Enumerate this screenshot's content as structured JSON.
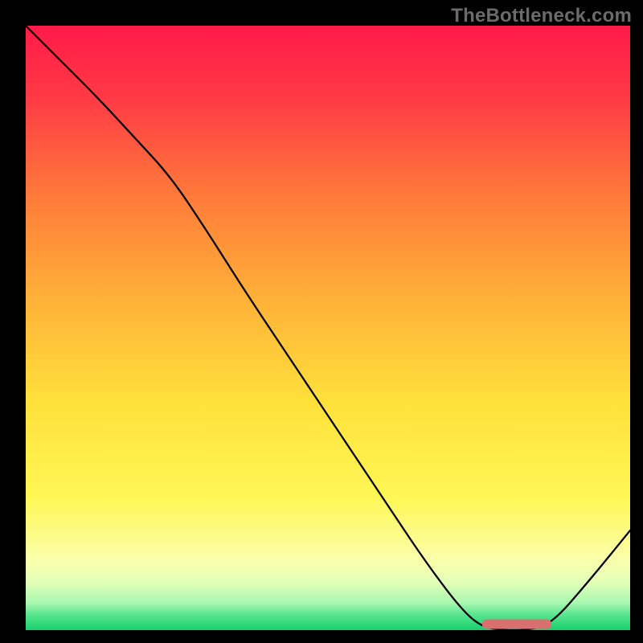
{
  "watermark": "TheBottleneck.com",
  "chart_data": {
    "type": "line",
    "title": "",
    "xlabel": "",
    "ylabel": "",
    "xlim": [
      0,
      1
    ],
    "ylim": [
      0,
      1
    ],
    "series": [
      {
        "name": "curve",
        "x": [
          0.0,
          0.06,
          0.12,
          0.18,
          0.24,
          0.3,
          0.36,
          0.42,
          0.48,
          0.54,
          0.6,
          0.66,
          0.72,
          0.755,
          0.79,
          0.83,
          0.87,
          0.935,
          1.0
        ],
        "y": [
          1.0,
          0.94,
          0.88,
          0.815,
          0.75,
          0.66,
          0.565,
          0.475,
          0.385,
          0.295,
          0.205,
          0.115,
          0.035,
          0.005,
          0.0,
          0.0,
          0.01,
          0.085,
          0.165
        ]
      }
    ],
    "markers": [
      {
        "name": "optimal-bar",
        "shape": "rounded-rect",
        "color": "#d9706f",
        "x_start": 0.755,
        "x_end": 0.87,
        "y": 0.002,
        "height": 0.016
      }
    ],
    "background_gradient": {
      "direction": "top-to-bottom",
      "stops": [
        {
          "pos": 0.0,
          "color": "#ff1a49"
        },
        {
          "pos": 0.12,
          "color": "#ff3a45"
        },
        {
          "pos": 0.28,
          "color": "#ff7a3a"
        },
        {
          "pos": 0.45,
          "color": "#ffb038"
        },
        {
          "pos": 0.62,
          "color": "#ffe03a"
        },
        {
          "pos": 0.78,
          "color": "#fff755"
        },
        {
          "pos": 0.88,
          "color": "#fbffa8"
        },
        {
          "pos": 0.92,
          "color": "#e4ffb8"
        },
        {
          "pos": 0.955,
          "color": "#a8f8b0"
        },
        {
          "pos": 0.975,
          "color": "#57e58e"
        },
        {
          "pos": 1.0,
          "color": "#18cf6d"
        }
      ]
    }
  }
}
